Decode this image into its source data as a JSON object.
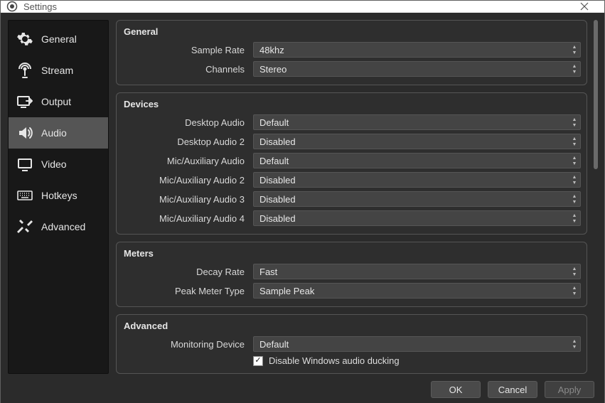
{
  "window": {
    "title": "Settings"
  },
  "sidebar": {
    "items": [
      {
        "label": "General"
      },
      {
        "label": "Stream"
      },
      {
        "label": "Output"
      },
      {
        "label": "Audio"
      },
      {
        "label": "Video"
      },
      {
        "label": "Hotkeys"
      },
      {
        "label": "Advanced"
      }
    ]
  },
  "groups": {
    "general": {
      "title": "General",
      "sample_rate_label": "Sample Rate",
      "sample_rate_value": "48khz",
      "channels_label": "Channels",
      "channels_value": "Stereo"
    },
    "devices": {
      "title": "Devices",
      "desktop_audio_label": "Desktop Audio",
      "desktop_audio_value": "Default",
      "desktop_audio2_label": "Desktop Audio 2",
      "desktop_audio2_value": "Disabled",
      "mic_aux_label": "Mic/Auxiliary Audio",
      "mic_aux_value": "Default",
      "mic_aux2_label": "Mic/Auxiliary Audio 2",
      "mic_aux2_value": "Disabled",
      "mic_aux3_label": "Mic/Auxiliary Audio 3",
      "mic_aux3_value": "Disabled",
      "mic_aux4_label": "Mic/Auxiliary Audio 4",
      "mic_aux4_value": "Disabled"
    },
    "meters": {
      "title": "Meters",
      "decay_rate_label": "Decay Rate",
      "decay_rate_value": "Fast",
      "peak_meter_type_label": "Peak Meter Type",
      "peak_meter_type_value": "Sample Peak"
    },
    "advanced": {
      "title": "Advanced",
      "monitoring_device_label": "Monitoring Device",
      "monitoring_device_value": "Default",
      "disable_ducking_label": "Disable Windows audio ducking",
      "disable_ducking_checked": true
    }
  },
  "footer": {
    "ok": "OK",
    "cancel": "Cancel",
    "apply": "Apply"
  }
}
